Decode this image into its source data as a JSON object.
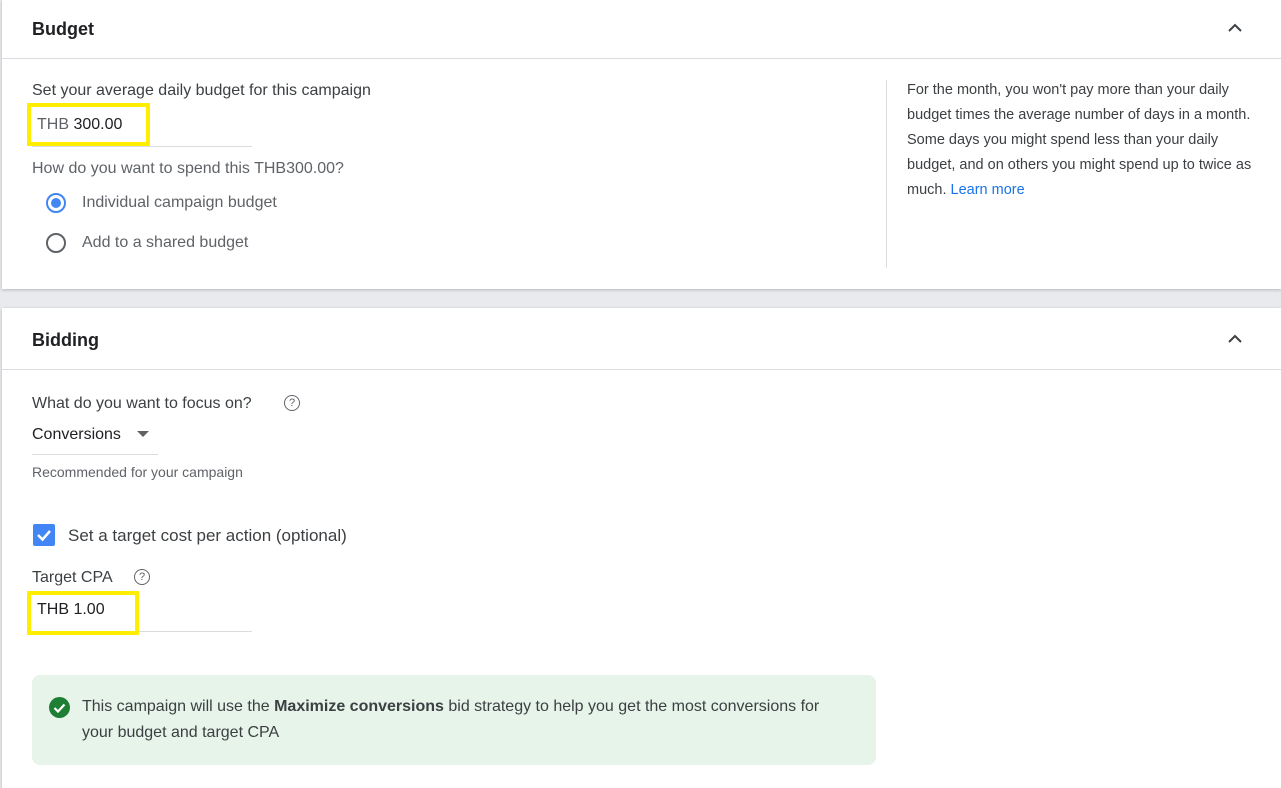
{
  "budget": {
    "title": "Budget",
    "prompt": "Set your average daily budget for this campaign",
    "currency": "THB",
    "amount": "300.00",
    "spend_question": "How do you want to spend this THB300.00?",
    "options": [
      {
        "label": "Individual campaign budget",
        "selected": true
      },
      {
        "label": "Add to a shared budget",
        "selected": false
      }
    ],
    "info_text": "For the month, you won't pay more than your daily budget times the average number of days in a month. Some days you might spend less than your daily budget, and on others you might spend up to twice as much.",
    "learn_more": "Learn more"
  },
  "bidding": {
    "title": "Bidding",
    "focus_label": "What do you want to focus on?",
    "focus_value": "Conversions",
    "recommended": "Recommended for your campaign",
    "target_checkbox_label": "Set a target cost per action (optional)",
    "target_checked": true,
    "target_cpa_label": "Target CPA",
    "target_cpa_value": "THB 1.00",
    "notice_pre": "This campaign will use the ",
    "notice_bold": "Maximize conversions",
    "notice_post": " bid strategy to help you get the most conversions for your budget and target CPA"
  },
  "colors": {
    "accent": "#4285f4",
    "highlight": "#ffee00",
    "success": "#1e8e3e",
    "notice_bg": "#e6f4ea"
  }
}
